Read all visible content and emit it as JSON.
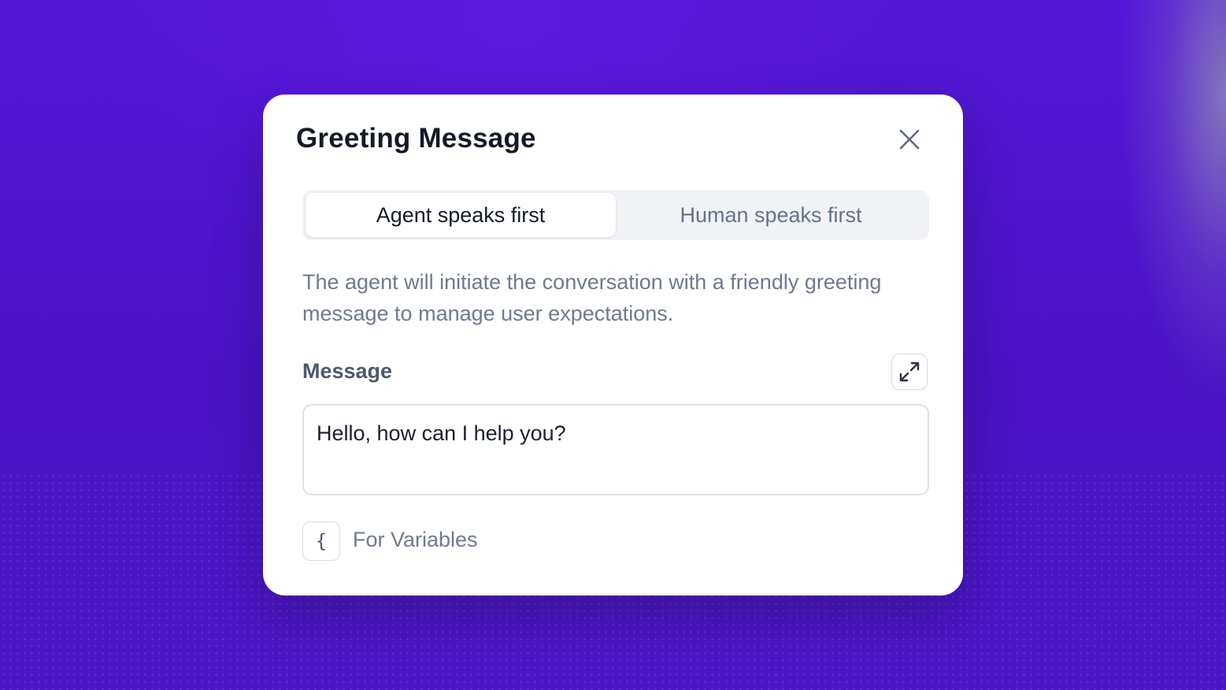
{
  "dialog": {
    "title": "Greeting Message",
    "close_icon": "close-icon"
  },
  "tabs": [
    {
      "label": "Agent speaks first",
      "active": true
    },
    {
      "label": "Human speaks first",
      "active": false
    }
  ],
  "description": "The agent will initiate the conversation with a friendly greeting message to manage user expectations.",
  "message": {
    "label": "Message",
    "value": "Hello, how can I help you?",
    "expand_icon": "expand-icon"
  },
  "variables": {
    "key_hint": "{",
    "label": "For Variables"
  },
  "colors": {
    "background": "#4a14c4",
    "title": "#141a26",
    "muted_text": "#6f7a90",
    "tab_track": "#f1f3f6"
  }
}
